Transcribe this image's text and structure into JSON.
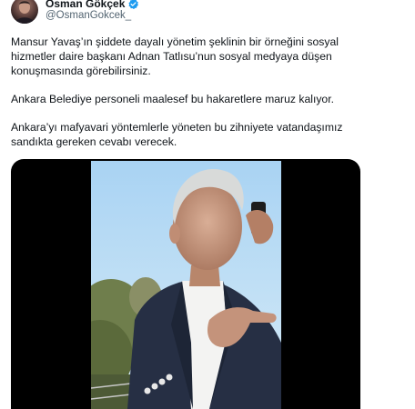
{
  "author": {
    "display_name": "Osman Gökçek",
    "handle": "@OsmanGokcek_",
    "verified": true,
    "avatar_icon": "profile-photo",
    "verified_color": "#1d9bf0"
  },
  "tweet": {
    "paragraphs": [
      "Mansur Yavaş’ın şiddete dayalı yönetim şeklinin bir örneğini sosyal hizmetler daire başkanı Adnan Tatlısu’nun sosyal medyaya düşen konuşmasında görebilirsiniz.",
      "Ankara Belediye personeli maalesef bu hakaretlere maruz kalıyor.",
      "Ankara’yı mafyavari yöntemlerle yöneten bu zihniyete vatandaşımız sandıkta gereken cevabı verecek."
    ]
  },
  "media": {
    "type": "video",
    "icon": "video-frame"
  }
}
